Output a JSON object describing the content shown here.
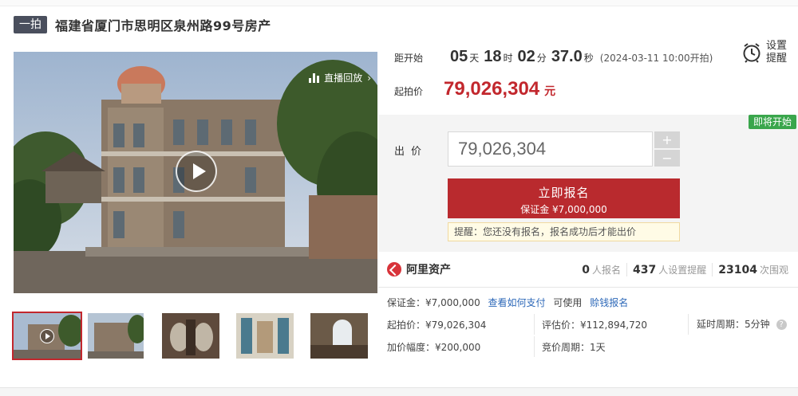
{
  "header": {
    "tag": "一拍",
    "title": "福建省厦门市思明区泉州路99号房产"
  },
  "media": {
    "replay_label": "直播回放",
    "replay_chevron": "›",
    "thumb_count": 5
  },
  "countdown": {
    "label": "距开始",
    "days": "05",
    "days_unit": "天",
    "hours": "18",
    "hours_unit": "时",
    "minutes": "02",
    "minutes_unit": "分",
    "seconds": "37.0",
    "seconds_unit": "秒",
    "start_time": "(2024-03-11 10:00开拍)"
  },
  "reminder": {
    "label": "设置提醒",
    "icon": "alarm-clock-icon"
  },
  "start_price": {
    "label": "起拍价",
    "value": "79,026,304",
    "unit": "元"
  },
  "bid": {
    "status_badge": "即将开始",
    "label": "出价",
    "input_value": "79,026,304",
    "plus": "+",
    "minus": "−",
    "signup_main": "立即报名",
    "signup_sub": "保证金 ¥7,000,000",
    "notice": "提醒：您还没有报名，报名成功后才能出价"
  },
  "platform": {
    "name": "阿里资产",
    "stats": [
      {
        "num": "0",
        "text": "人报名"
      },
      {
        "num": "437",
        "text": "人设置提醒"
      },
      {
        "num": "23104",
        "text": "次围观"
      }
    ]
  },
  "details": {
    "deposit_label": "保证金：¥7,000,000",
    "how_to_pay": "查看如何支付",
    "available": "可使用",
    "pay_later": "赊钱报名",
    "start_price": "起拍价：¥79,026,304",
    "appraisal": "评估价：¥112,894,720",
    "extension": "延时周期：5分钟",
    "increment": "加价幅度：¥200,000",
    "bid_cycle": "竞价周期：1天"
  },
  "colors": {
    "accent": "#c2272d",
    "badge_green": "#3aa64c",
    "link": "#2d68b8"
  }
}
